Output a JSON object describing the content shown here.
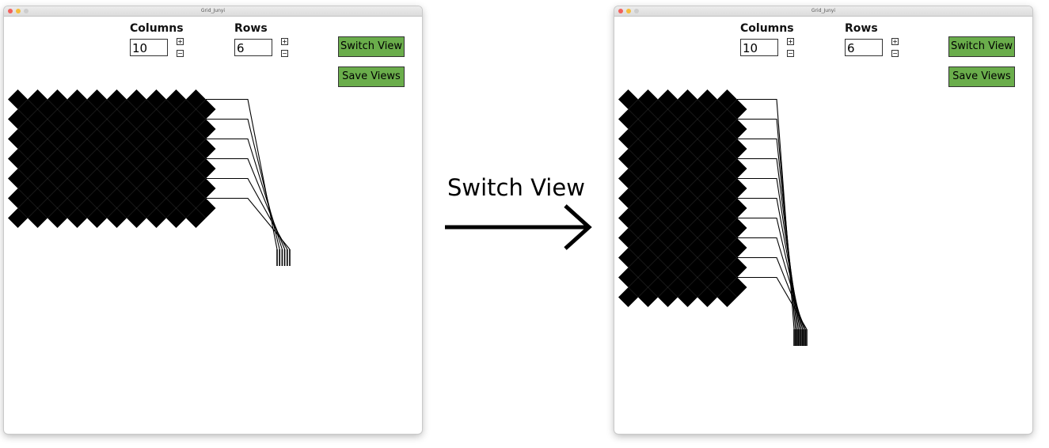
{
  "transition_caption": "Switch View",
  "windows": [
    {
      "title": "Grid_Junyi",
      "columns_label": "Columns",
      "columns_value": "10",
      "rows_label": "Rows",
      "rows_value": "6",
      "plus_label": "+",
      "minus_label": "−",
      "switch_view_label": "Switch View",
      "save_views_label": "Save Views",
      "board": {
        "cols": 10,
        "rows": 6,
        "lead_lines": 6
      }
    },
    {
      "title": "Grid_Junyi",
      "columns_label": "Columns",
      "columns_value": "10",
      "rows_label": "Rows",
      "rows_value": "6",
      "plus_label": "+",
      "minus_label": "−",
      "switch_view_label": "Switch View",
      "save_views_label": "Save Views",
      "board": {
        "cols": 6,
        "rows": 10,
        "lead_lines": 10
      }
    }
  ],
  "colors": {
    "button_green": "#6aad4b",
    "diamond": "#000000",
    "close": "#f2605b",
    "minimize": "#f6bd3b"
  }
}
